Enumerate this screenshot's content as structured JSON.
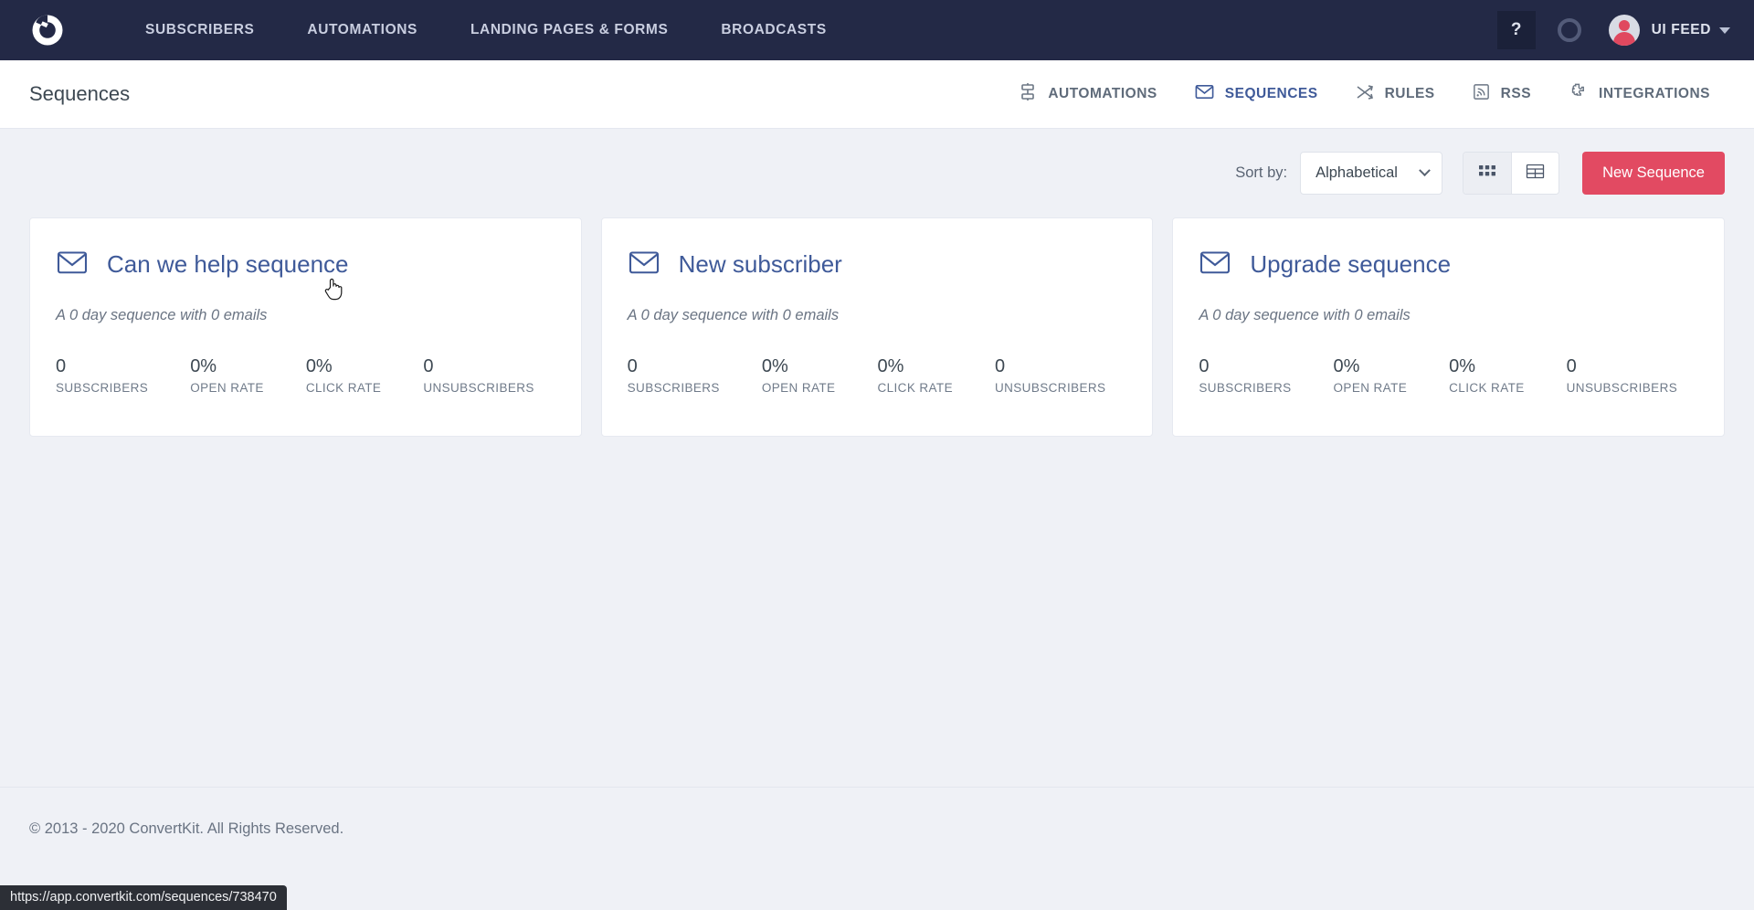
{
  "topnav": {
    "logo_icon": "convertkit-logo-icon",
    "links": [
      {
        "label": "SUBSCRIBERS"
      },
      {
        "label": "AUTOMATIONS"
      },
      {
        "label": "LANDING PAGES & FORMS"
      },
      {
        "label": "BROADCASTS"
      }
    ],
    "help_label": "?",
    "ring_icon": "status-ring-icon",
    "account": {
      "name": "UI FEED",
      "avatar_icon": "user-avatar-icon",
      "caret_icon": "chevron-down-icon"
    },
    "background_color": "#232946"
  },
  "subheader": {
    "title": "Sequences",
    "links": [
      {
        "label": "AUTOMATIONS",
        "icon": "automations-flow-icon",
        "active": false
      },
      {
        "label": "SEQUENCES",
        "icon": "envelope-icon",
        "active": true
      },
      {
        "label": "RULES",
        "icon": "shuffle-arrows-icon",
        "active": false
      },
      {
        "label": "RSS",
        "icon": "rss-icon",
        "active": false
      },
      {
        "label": "INTEGRATIONS",
        "icon": "puzzle-piece-icon",
        "active": false
      }
    ],
    "active_color": "#3f5a99"
  },
  "toolbar": {
    "sort_label": "Sort by:",
    "sort_value": "Alphabetical",
    "sort_options": [
      "Alphabetical"
    ],
    "grid_view_icon": "grid-view-icon",
    "table_view_icon": "table-view-icon",
    "active_view": "grid",
    "new_sequence_label": "New Sequence",
    "new_sequence_color": "#e24a62"
  },
  "sequences": [
    {
      "icon": "envelope-icon",
      "title": "Can we help sequence",
      "subtitle": "A 0 day sequence with 0 emails",
      "stats": [
        {
          "value": "0",
          "label": "SUBSCRIBERS"
        },
        {
          "value": "0%",
          "label": "OPEN RATE"
        },
        {
          "value": "0%",
          "label": "CLICK RATE"
        },
        {
          "value": "0",
          "label": "UNSUBSCRIBERS"
        }
      ]
    },
    {
      "icon": "envelope-icon",
      "title": "New subscriber",
      "subtitle": "A 0 day sequence with 0 emails",
      "stats": [
        {
          "value": "0",
          "label": "SUBSCRIBERS"
        },
        {
          "value": "0%",
          "label": "OPEN RATE"
        },
        {
          "value": "0%",
          "label": "CLICK RATE"
        },
        {
          "value": "0",
          "label": "UNSUBSCRIBERS"
        }
      ]
    },
    {
      "icon": "envelope-icon",
      "title": "Upgrade sequence",
      "subtitle": "A 0 day sequence with 0 emails",
      "stats": [
        {
          "value": "0",
          "label": "SUBSCRIBERS"
        },
        {
          "value": "0%",
          "label": "OPEN RATE"
        },
        {
          "value": "0%",
          "label": "CLICK RATE"
        },
        {
          "value": "0",
          "label": "UNSUBSCRIBERS"
        }
      ]
    }
  ],
  "footer": {
    "copyright": "© 2013 - 2020 ConvertKit. All Rights Reserved."
  },
  "statusbar": {
    "url": "https://app.convertkit.com/sequences/738470"
  }
}
